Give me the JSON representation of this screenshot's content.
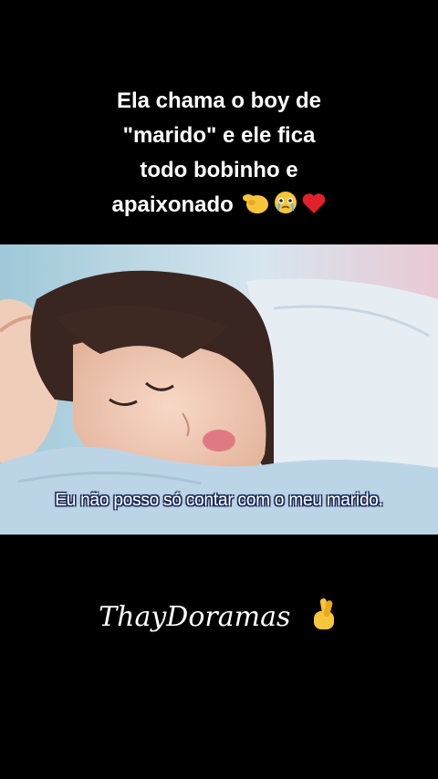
{
  "caption": {
    "lines": [
      "Ela chama o boy de",
      "\"marido\" e ele fica",
      "todo bobinho e",
      "apaixonado"
    ],
    "emojis": [
      "pinching-hand-icon",
      "crying-face-icon",
      "red-heart-icon"
    ]
  },
  "video": {
    "subtitle": "Eu não posso só contar com o meu marido."
  },
  "watermark": {
    "text": "ThayDoramas",
    "emoji": "crossed-fingers-icon"
  }
}
